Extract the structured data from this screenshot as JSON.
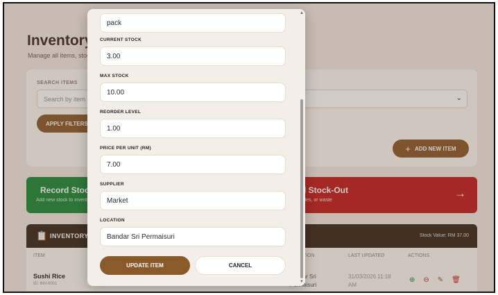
{
  "page": {
    "title": "Inventory",
    "subtitle": "Manage all items, stock levels"
  },
  "filters": {
    "search_label": "SEARCH ITEMS",
    "search_placeholder": "Search by item",
    "apply_label": "APPLY FILTERS",
    "add_label": "ADD NEW ITEM"
  },
  "stock_cards": {
    "in_title": "Record Stock-In",
    "in_subtitle": "Add new stock to inventory",
    "out_title": "Record Stock-Out",
    "out_subtitle": "Usage, sales, or waste"
  },
  "table": {
    "title": "INVENTORY",
    "stock_value": "Stock Value: RM 37.00",
    "columns": [
      "ITEM",
      "LOCATION",
      "LAST UPDATED",
      "ACTIONS"
    ],
    "rows": [
      {
        "name": "Sushi Rice",
        "id": "ID: INV-0001",
        "location": "Bandar Sri Permaisuri",
        "updated": "31/03/2026 11:18 AM"
      }
    ]
  },
  "modal": {
    "unit_value": "pack",
    "current_stock_label": "CURRENT STOCK",
    "current_stock_value": "3.00",
    "max_stock_label": "MAX STOCK",
    "max_stock_value": "10.00",
    "reorder_label": "REORDER LEVEL",
    "reorder_value": "1.00",
    "price_label": "PRICE PER UNIT (RM)",
    "price_value": "7.00",
    "supplier_label": "SUPPLIER",
    "supplier_value": "Market",
    "location_label": "LOCATION",
    "location_value": "Bandar Sri Permaisuri",
    "update_label": "UPDATE ITEM",
    "cancel_label": "CANCEL"
  }
}
